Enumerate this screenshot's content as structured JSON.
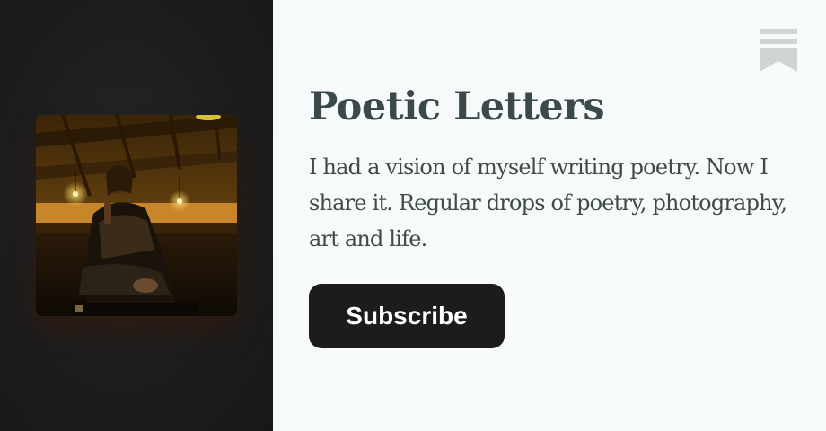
{
  "publication": {
    "title": "Poetic Letters",
    "description": "I had a vision of myself writing poetry. Now I share it. Regular drops of poetry, photography, art and life.",
    "subscribe_label": "Subscribe"
  },
  "icons": {
    "brand": "bookmark-icon",
    "cover": "cover-photo"
  },
  "colors": {
    "left_panel_bg": "#1d1d1d",
    "right_panel_bg": "#f7fafb",
    "title_text": "#3b4a48",
    "body_text": "#3f4b49",
    "button_bg": "#1c1c1c",
    "button_text": "#ffffff",
    "bookmark_gray": "#cfd4d5"
  }
}
